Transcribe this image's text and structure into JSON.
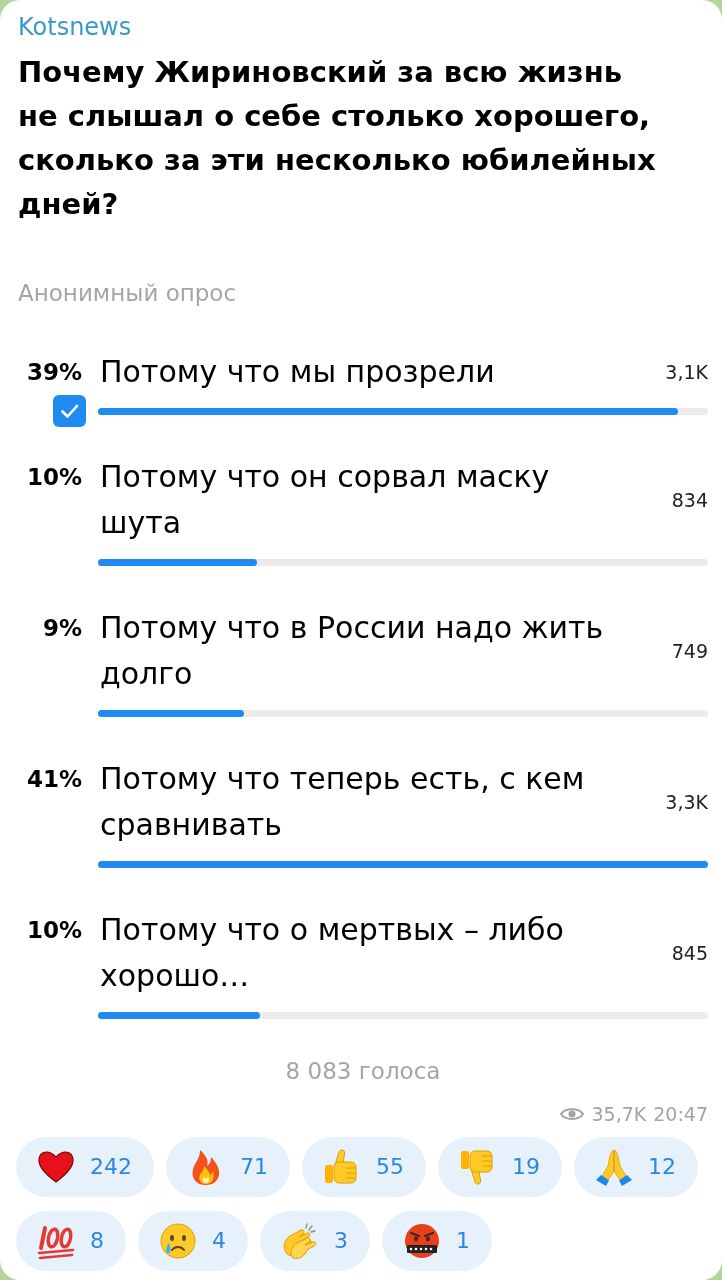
{
  "channel": {
    "name": "Kotsnews"
  },
  "poll": {
    "question": "Почему Жириновский за всю жизнь не слышал о себе столько хорошего, сколько за эти несколько юбилейных дней?",
    "type": "Анонимный опрос",
    "options": [
      {
        "percent": "39%",
        "text": "Потому что мы прозрели",
        "votes": "3,1K",
        "level": 0.95,
        "selected": true
      },
      {
        "percent": "10%",
        "text": "Потому что он сорвал маску шута",
        "votes": "834",
        "level": 0.26,
        "selected": false
      },
      {
        "percent": "9%",
        "text": "Потому что в России надо жить долго",
        "votes": "749",
        "level": 0.24,
        "selected": false
      },
      {
        "percent": "41%",
        "text": "Потому что теперь есть, с кем сравнивать",
        "votes": "3,3K",
        "level": 1,
        "selected": false
      },
      {
        "percent": "10%",
        "text": "Потому что о мертвых – либо хорошо…",
        "votes": "845",
        "level": 0.265,
        "selected": false
      }
    ],
    "total": "8 083 голоса"
  },
  "footer": {
    "views": "35,7K",
    "time": "20:47"
  },
  "reactions": [
    {
      "kind": "heart",
      "count": "242"
    },
    {
      "kind": "fire",
      "count": "71"
    },
    {
      "kind": "thumbs_up",
      "count": "55"
    },
    {
      "kind": "thumbs_down",
      "count": "19"
    },
    {
      "kind": "pray",
      "count": "12"
    },
    {
      "kind": "hundred",
      "count": "8"
    },
    {
      "kind": "crying",
      "count": "4"
    },
    {
      "kind": "clap",
      "count": "3"
    },
    {
      "kind": "cursing",
      "count": "1"
    }
  ]
}
